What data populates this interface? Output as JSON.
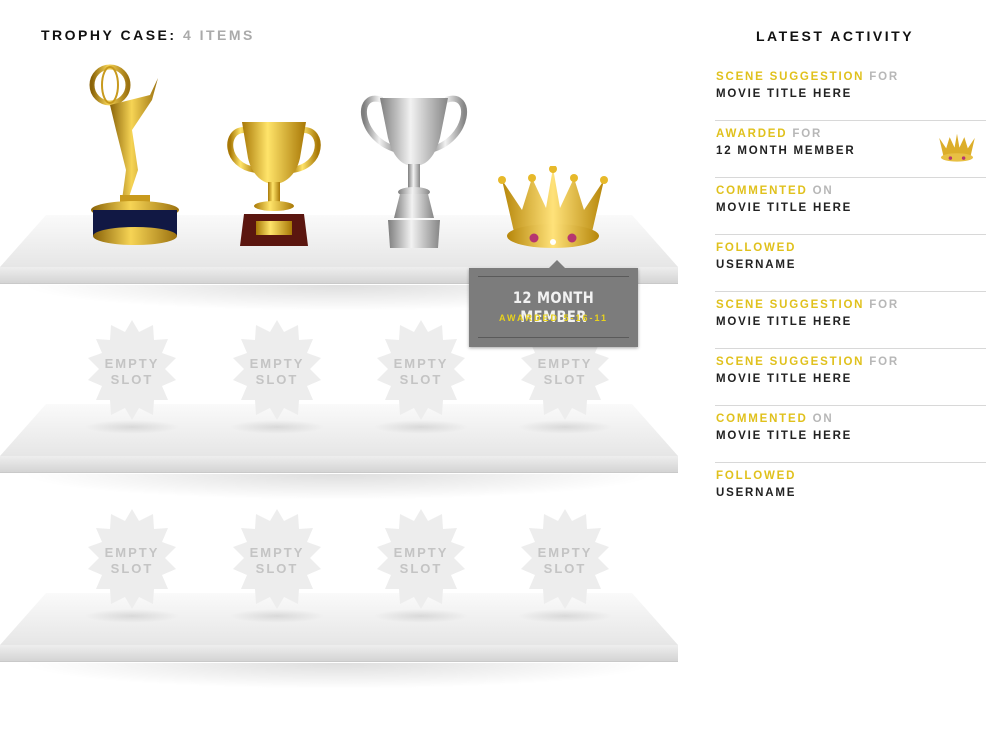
{
  "trophy_case": {
    "title": "TROPHY CASE:",
    "count": "4 ITEMS",
    "trophies": [
      {
        "name": "emmy-statuette-icon"
      },
      {
        "name": "gold-cup-trophy-icon"
      },
      {
        "name": "silver-cup-trophy-icon"
      },
      {
        "name": "crown-icon"
      }
    ],
    "empty_slot_line1": "EMPTY",
    "empty_slot_line2": "SLOT"
  },
  "tooltip": {
    "title": "12 MONTH MEMBER",
    "subtitle": "AWARDED 5-16-11"
  },
  "activity": {
    "title": "LATEST ACTIVITY",
    "items": [
      {
        "verb": "SCENE SUGGESTION",
        "prep": "FOR",
        "object": "MOVIE TITLE HERE"
      },
      {
        "verb": "AWARDED",
        "prep": "FOR",
        "object": "12 MONTH MEMBER",
        "icon": "crown-icon"
      },
      {
        "verb": "COMMENTED",
        "prep": "ON",
        "object": "MOVIE TITLE HERE"
      },
      {
        "verb": "FOLLOWED",
        "prep": "",
        "object": "USERNAME"
      },
      {
        "verb": "SCENE SUGGESTION",
        "prep": "FOR",
        "object": "MOVIE TITLE HERE"
      },
      {
        "verb": "SCENE SUGGESTION",
        "prep": "FOR",
        "object": "MOVIE TITLE HERE"
      },
      {
        "verb": "COMMENTED",
        "prep": "ON",
        "object": "MOVIE TITLE HERE"
      },
      {
        "verb": "FOLLOWED",
        "prep": "",
        "object": "USERNAME"
      }
    ]
  },
  "colors": {
    "accent_yellow": "#e0c11d",
    "muted_gray": "#b7b7b7",
    "tooltip_bg": "#7c7c7c"
  }
}
